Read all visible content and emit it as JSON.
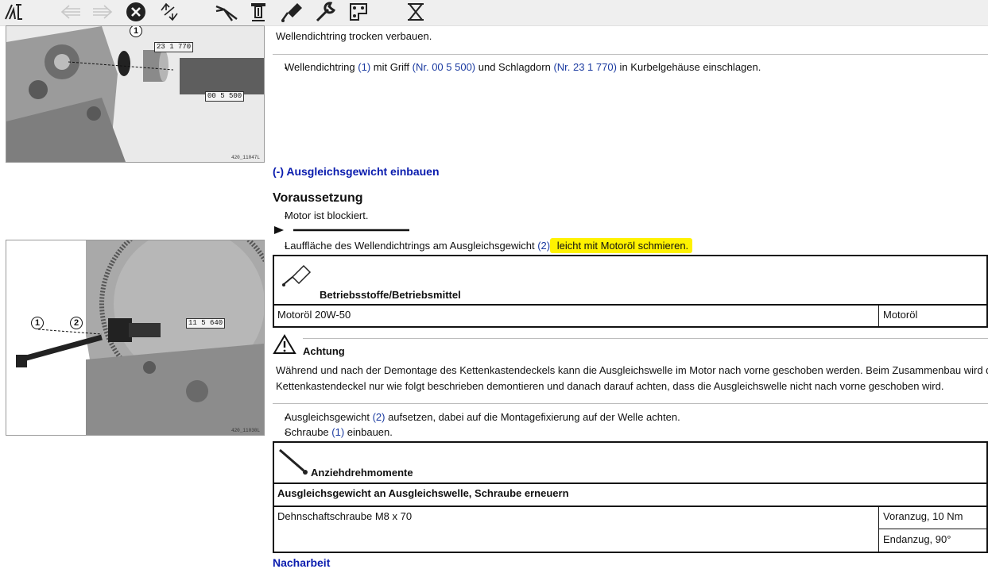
{
  "toolbar": {
    "items": [
      "app-logo",
      "back",
      "forward",
      "close",
      "refresh",
      "tool-pliers",
      "tool-press",
      "tool-oil",
      "tool-wrench",
      "tool-template",
      "tool-special"
    ]
  },
  "figures": [
    {
      "callouts": [
        "23 1 770",
        "00 5 500"
      ],
      "numbers": [
        "1"
      ],
      "id": "420_11047L"
    },
    {
      "callouts": [
        "11 5 640"
      ],
      "numbers": [
        "1",
        "2"
      ],
      "id": "420_11030L"
    }
  ],
  "content": {
    "line1": "Wellendichtring trocken verbauen.",
    "step1": {
      "a": "Wellendichtring ",
      "b": "(1)",
      "c": " mit Griff ",
      "d": "(Nr. 00 5 500)",
      "e": " und Schlagdorn ",
      "f": "(Nr. 23 1 770)",
      "g": " in Kurbelgehäuse einschlagen."
    },
    "section_title": "(-) Ausgleichsgewicht einbauen",
    "voraussetzung": "Voraussetzung",
    "motor": "Motor ist blockiert.",
    "step2": {
      "a": "Lauffläche des Wellendichtrings am Ausgleichsgewicht ",
      "b": "(2)",
      "c": " ",
      "d": "leicht mit Motoröl schmieren."
    },
    "table1": {
      "header": "Betriebsstoffe/Betriebsmittel",
      "row": [
        "Motoröl 20W-50",
        "Motoröl"
      ]
    },
    "warning": {
      "title": "Achtung",
      "text1": "Während und nach der Demontage des Kettenkastendeckels kann die Ausgleichswelle im Motor nach vorne geschoben werden. Beim Zusammenbau wird d",
      "text2": "Kettenkastendeckel nur wie folgt beschrieben demontieren und danach darauf achten, dass die Ausgleichswelle nicht nach vorne geschoben wird."
    },
    "step3": {
      "a": "Ausgleichsgewicht ",
      "b": "(2)",
      "c": " aufsetzen, dabei auf die Montagefixierung auf der Welle achten."
    },
    "step4": {
      "a": "Schraube ",
      "b": "(1)",
      "c": " einbauen."
    },
    "table2": {
      "header": "Anziehdrehmomente",
      "subheader": "Ausgleichsgewicht an Ausgleichswelle, Schraube erneuern",
      "part": "Dehnschaftschraube M8 x 70",
      "val1": "Voranzug, 10 Nm",
      "val2": "Endanzug, 90°"
    },
    "nacharbeit": "Nacharbeit"
  }
}
